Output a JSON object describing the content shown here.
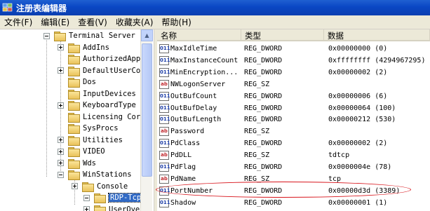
{
  "window": {
    "title": "注册表编辑器"
  },
  "menu": [
    "文件(F)",
    "编辑(E)",
    "查看(V)",
    "收藏夹(A)",
    "帮助(H)"
  ],
  "tree": [
    {
      "label": "Terminal Server",
      "expander": "minus"
    },
    {
      "label": "AddIns",
      "expander": "plus"
    },
    {
      "label": "AuthorizedAppl",
      "expander": "none"
    },
    {
      "label": "DefaultUserCon",
      "expander": "plus"
    },
    {
      "label": "Dos",
      "expander": "none"
    },
    {
      "label": "InputDevices",
      "expander": "none"
    },
    {
      "label": "KeyboardType M",
      "expander": "plus"
    },
    {
      "label": "Licensing Core",
      "expander": "none"
    },
    {
      "label": "SysProcs",
      "expander": "none"
    },
    {
      "label": "Utilities",
      "expander": "plus"
    },
    {
      "label": "VIDEO",
      "expander": "plus"
    },
    {
      "label": "Wds",
      "expander": "plus"
    },
    {
      "label": "WinStations",
      "expander": "minus"
    },
    {
      "label": "Console",
      "expander": "plus"
    },
    {
      "label": "RDP-Tcp",
      "expander": "minus",
      "selected": true
    },
    {
      "label": "UserOve",
      "expander": "plus"
    }
  ],
  "list": {
    "columns": [
      "名称",
      "类型",
      "数据"
    ],
    "rows": [
      {
        "icon": "binary-value-icon",
        "name": "MaxIdleTime",
        "type": "REG_DWORD",
        "data": "0x00000000 (0)"
      },
      {
        "icon": "binary-value-icon",
        "name": "MaxInstanceCount",
        "type": "REG_DWORD",
        "data": "0xffffffff (4294967295)"
      },
      {
        "icon": "binary-value-icon",
        "name": "MinEncryption...",
        "type": "REG_DWORD",
        "data": "0x00000002 (2)"
      },
      {
        "icon": "string-value-icon",
        "name": "NWLogonServer",
        "type": "REG_SZ",
        "data": ""
      },
      {
        "icon": "binary-value-icon",
        "name": "OutBufCount",
        "type": "REG_DWORD",
        "data": "0x00000006 (6)"
      },
      {
        "icon": "binary-value-icon",
        "name": "OutBufDelay",
        "type": "REG_DWORD",
        "data": "0x00000064 (100)"
      },
      {
        "icon": "binary-value-icon",
        "name": "OutBufLength",
        "type": "REG_DWORD",
        "data": "0x00000212 (530)"
      },
      {
        "icon": "string-value-icon",
        "name": "Password",
        "type": "REG_SZ",
        "data": ""
      },
      {
        "icon": "binary-value-icon",
        "name": "PdClass",
        "type": "REG_DWORD",
        "data": "0x00000002 (2)"
      },
      {
        "icon": "string-value-icon",
        "name": "PdDLL",
        "type": "REG_SZ",
        "data": "tdtcp"
      },
      {
        "icon": "binary-value-icon",
        "name": "PdFlag",
        "type": "REG_DWORD",
        "data": "0x0000004e (78)"
      },
      {
        "icon": "string-value-icon",
        "name": "PdName",
        "type": "REG_SZ",
        "data": "tcp"
      },
      {
        "icon": "binary-value-icon",
        "name": "PortNumber",
        "type": "REG_DWORD",
        "data": "0x00000d3d (3389)",
        "highlighted": true
      },
      {
        "icon": "binary-value-icon",
        "name": "Shadow",
        "type": "REG_DWORD",
        "data": "0x00000001 (1)"
      }
    ]
  },
  "colors": {
    "titlebar": "#0a47c4",
    "selection": "#316ac5",
    "annotation": "#d8141b"
  }
}
